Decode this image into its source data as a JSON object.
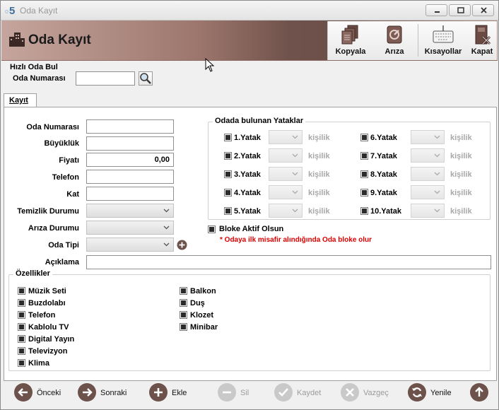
{
  "window": {
    "title": "Oda Kayıt"
  },
  "header": {
    "title": "Oda Kayıt"
  },
  "toolbar": {
    "copy": "Kopyala",
    "fault": "Arıza",
    "shortcuts": "Kısayollar",
    "close": "Kapat"
  },
  "quick_find": {
    "title": "Hızlı Oda Bul",
    "room_label": "Oda Numarası",
    "room_value": ""
  },
  "tab": {
    "label": "Kayıt"
  },
  "form": {
    "room_number": {
      "label": "Oda Numarası",
      "value": ""
    },
    "size": {
      "label": "Büyüklük",
      "value": ""
    },
    "price": {
      "label": "Fiyatı",
      "value": "0,00"
    },
    "phone": {
      "label": "Telefon",
      "value": ""
    },
    "floor": {
      "label": "Kat",
      "value": ""
    },
    "cleaning": {
      "label": "Temizlik Durumu",
      "value": ""
    },
    "fault": {
      "label": "Arıza Durumu",
      "value": ""
    },
    "room_type": {
      "label": "Oda Tipi",
      "value": ""
    },
    "description": {
      "label": "Açıklama",
      "value": ""
    }
  },
  "beds": {
    "title": "Odada bulunan Yataklar",
    "unit": "kişilik",
    "left": [
      "1.Yatak",
      "2.Yatak",
      "3.Yatak",
      "4.Yatak",
      "5.Yatak"
    ],
    "right": [
      "6.Yatak",
      "7.Yatak",
      "8.Yatak",
      "9.Yatak",
      "10.Yatak"
    ]
  },
  "block": {
    "label": "Bloke Aktif Olsun",
    "note": "* Odaya ilk misafir alındığında Oda bloke olur"
  },
  "features": {
    "title": "Özellikler",
    "col1": [
      "Müzik Seti",
      "Buzdolabı",
      "Telefon",
      "Kablolu TV",
      "Digital Yayın",
      "Televizyon",
      "Klima"
    ],
    "col2": [
      "Balkon",
      "Duş",
      "Klozet",
      "Minibar"
    ]
  },
  "bottom": {
    "prev": "Önceki",
    "next": "Sonraki",
    "add": "Ekle",
    "delete": "Sil",
    "save": "Kaydet",
    "cancel": "Vazgeç",
    "refresh": "Yenile"
  },
  "colors": {
    "accent": "#6d524c",
    "note": "#e00000"
  }
}
